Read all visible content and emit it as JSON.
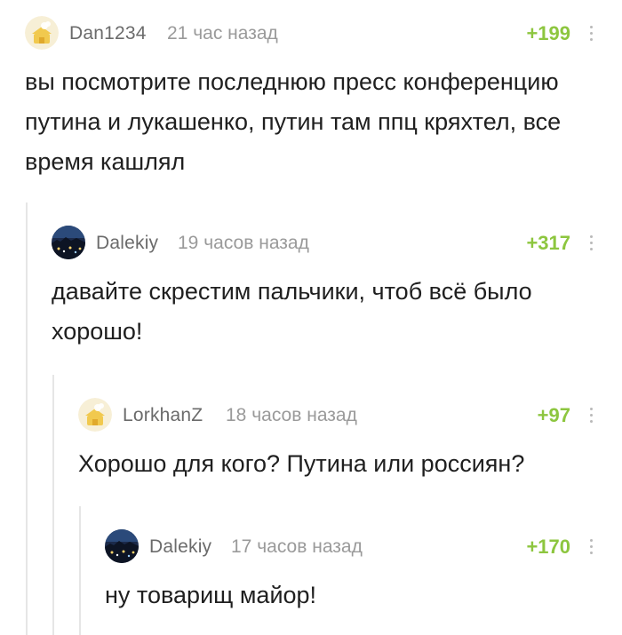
{
  "comments": [
    {
      "username": "Dan1234",
      "time": "21 час назад",
      "rating": "+199",
      "text": "вы посмотрите последнюю пресс конференцию путина и лукашенко, путин там ппц кряхтел, все время кашлял",
      "avatar": "default-pikabu-avatar-icon"
    },
    {
      "username": "Dalekiy",
      "time": "19 часов назад",
      "rating": "+317",
      "text": "давайте скрестим пальчики, чтоб всё было хорошо!",
      "avatar": "night-city-photo-avatar"
    },
    {
      "username": "LorkhanZ",
      "time": "18 часов назад",
      "rating": "+97",
      "text": "Хорошо для кого? Путина или россиян?",
      "avatar": "default-pikabu-avatar-icon"
    },
    {
      "username": "Dalekiy",
      "time": "17 часов назад",
      "rating": "+170",
      "text": "ну товарищ майор!",
      "avatar": "night-city-photo-avatar"
    }
  ],
  "colors": {
    "rating": "#8dc63f",
    "username": "#6b6b6b",
    "time": "#9a9a9a",
    "thread_line": "#e6e6e6"
  }
}
